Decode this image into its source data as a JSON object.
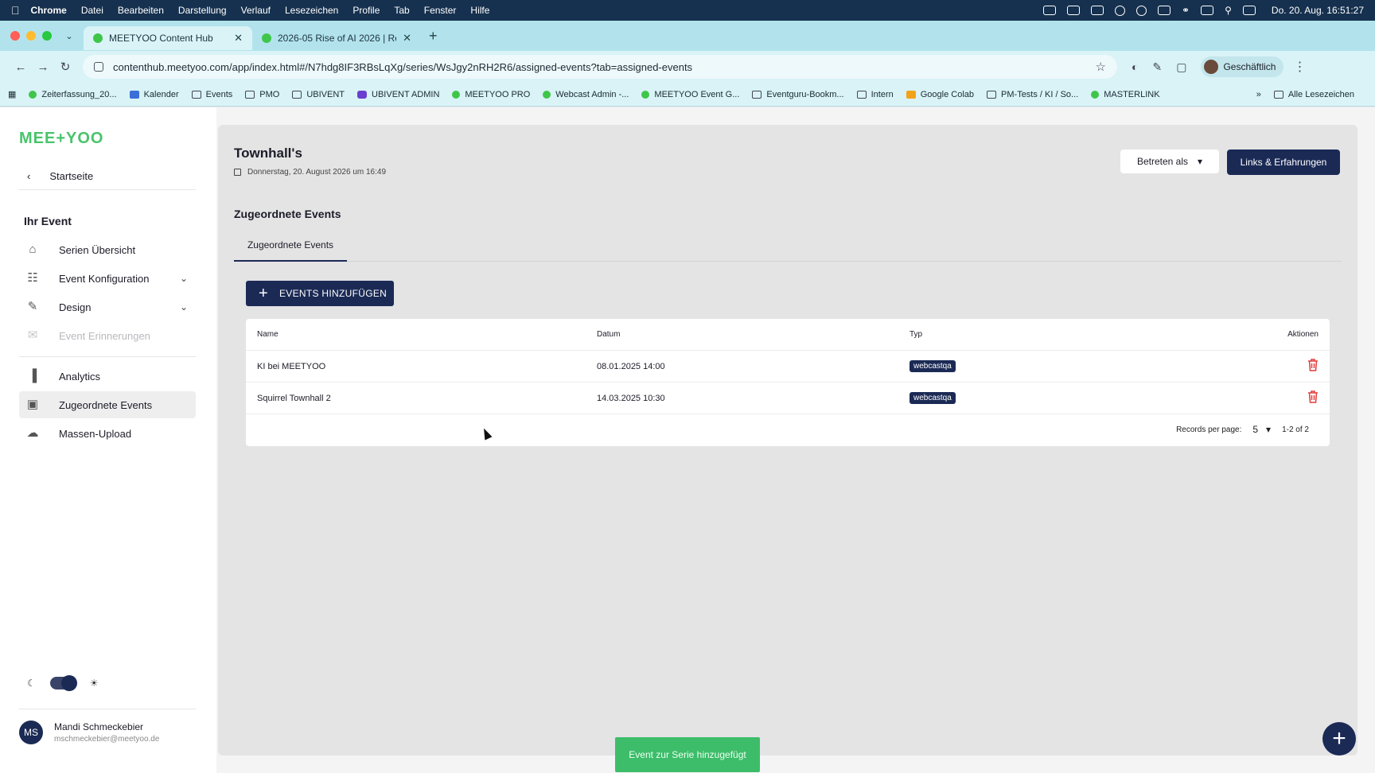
{
  "menubar": {
    "app": "Chrome",
    "items": [
      "Datei",
      "Bearbeiten",
      "Darstellung",
      "Verlauf",
      "Lesezeichen",
      "Profile",
      "Tab",
      "Fenster",
      "Hilfe"
    ],
    "clock": "Do. 20. Aug.  16:51:27"
  },
  "browser": {
    "tabs": [
      {
        "title": "MEETYOO Content Hub"
      },
      {
        "title": "2026-05 Rise of AI 2026 | Re"
      }
    ],
    "url": "contenthub.meetyoo.com/app/index.html#/N7hdg8IF3RBsLqXg/series/WsJgy2nRH2R6/assigned-events?tab=assigned-events",
    "profile": "Geschäftlich",
    "bookmarks": [
      {
        "label": "Zeiterfassung_20...",
        "icon": "green"
      },
      {
        "label": "Kalender",
        "icon": "blue"
      },
      {
        "label": "Events",
        "icon": "folder"
      },
      {
        "label": "PMO",
        "icon": "folder"
      },
      {
        "label": "UBIVENT",
        "icon": "folder"
      },
      {
        "label": "UBIVENT ADMIN",
        "icon": "purple"
      },
      {
        "label": "MEETYOO PRO",
        "icon": "green"
      },
      {
        "label": "Webcast Admin -...",
        "icon": "green"
      },
      {
        "label": "MEETYOO Event G...",
        "icon": "green"
      },
      {
        "label": "Eventguru-Bookm...",
        "icon": "folder"
      },
      {
        "label": "Intern",
        "icon": "folder"
      },
      {
        "label": "Google Colab",
        "icon": "orange"
      },
      {
        "label": "PM-Tests / KI / So...",
        "icon": "folder"
      },
      {
        "label": "MASTERLINK",
        "icon": "green"
      }
    ],
    "all_bookmarks": "Alle Lesezeichen"
  },
  "sidebar": {
    "logo": "MEE+YOO",
    "back": "Startseite",
    "section": "Ihr Event",
    "items": [
      {
        "label": "Serien Übersicht",
        "icon": "home-icon"
      },
      {
        "label": "Event Konfiguration",
        "icon": "config-icon"
      },
      {
        "label": "Design",
        "icon": "edit-icon"
      },
      {
        "label": "Event Erinnerungen",
        "icon": "mail-icon"
      },
      {
        "label": "Analytics",
        "icon": "bar-chart-icon"
      },
      {
        "label": "Zugeordnete Events",
        "icon": "playlist-icon"
      },
      {
        "label": "Massen-Upload",
        "icon": "cloud-upload-icon"
      }
    ],
    "user": {
      "initials": "MS",
      "name": "Mandi Schmeckebier",
      "email": "mschmeckebier@meetyoo.de"
    }
  },
  "main": {
    "title": "Townhall's",
    "date": "Donnerstag, 20. August 2026 um 16:49",
    "betreten_label": "Betreten als",
    "links_label": "Links & Erfahrungen",
    "subtitle": "Zugeordnete Events",
    "tab": "Zugeordnete Events",
    "add_label": "EVENTS HINZUFÜGEN",
    "table": {
      "headers": {
        "name": "Name",
        "date": "Datum",
        "type": "Typ",
        "actions": "Aktionen"
      },
      "rows": [
        {
          "name": "KI bei MEETYOO",
          "date": "08.01.2025 14:00",
          "type": "webcastqa"
        },
        {
          "name": "Squirrel Townhall 2",
          "date": "14.03.2025 10:30",
          "type": "webcastqa"
        }
      ]
    },
    "pager": {
      "label": "Records per page:",
      "per_page": "5",
      "range": "1-2 of 2"
    }
  },
  "toast": "Event zur Serie hinzugefügt",
  "colors": {
    "primary": "#1b2a55",
    "brand": "#48c46b",
    "danger": "#e23b3b",
    "toast": "#3dbd6a"
  }
}
